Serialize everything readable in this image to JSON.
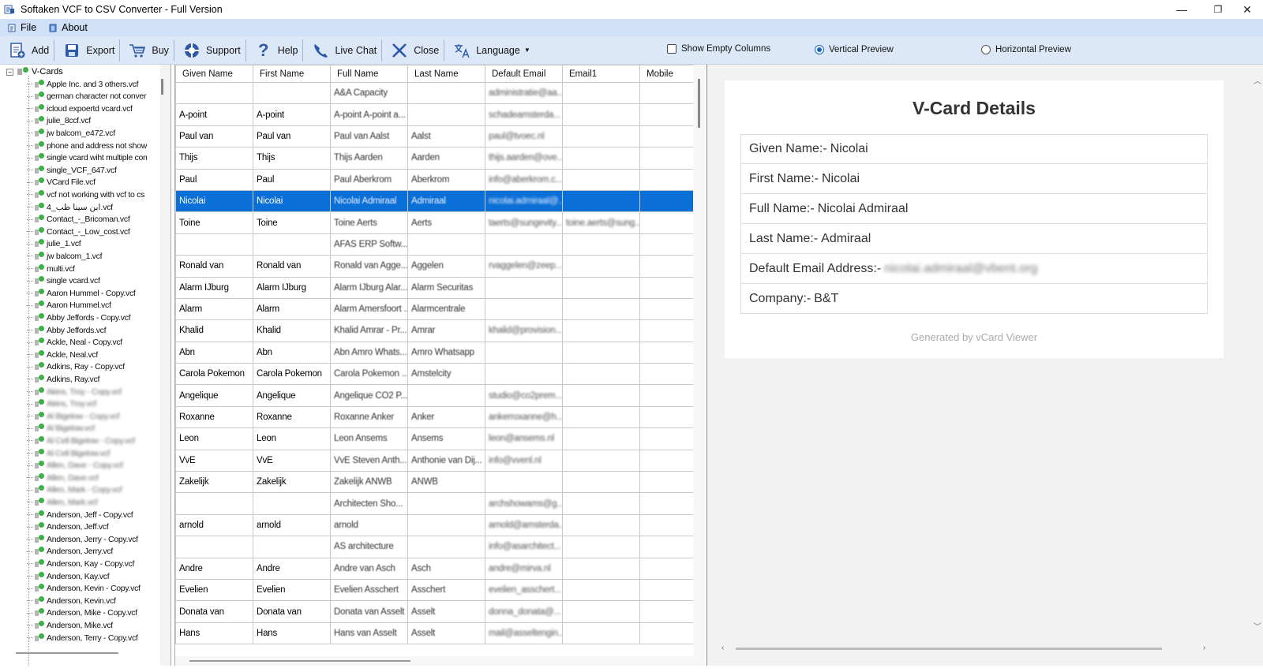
{
  "window": {
    "title": "Softaken VCF to CSV Converter - Full Version",
    "controls": [
      "—",
      "❐",
      "✕"
    ]
  },
  "menu": [
    {
      "label": "File",
      "icon": "file-icon"
    },
    {
      "label": "About",
      "icon": "about-icon"
    }
  ],
  "toolbar": {
    "buttons": [
      {
        "label": "Add",
        "icon": "add-icon"
      },
      {
        "label": "Export",
        "icon": "export-icon"
      },
      {
        "label": "Buy",
        "icon": "cart-icon"
      },
      {
        "label": "Support",
        "icon": "support-icon"
      },
      {
        "label": "Help",
        "icon": "help-icon"
      },
      {
        "label": "Live Chat",
        "icon": "phone-icon"
      },
      {
        "label": "Close",
        "icon": "close-icon"
      },
      {
        "label": "Language",
        "icon": "language-icon"
      }
    ],
    "show_empty_columns": {
      "label": "Show Empty Columns",
      "checked": false
    },
    "vertical_preview": {
      "label": "Vertical Preview",
      "selected": true
    },
    "horizontal_preview": {
      "label": "Horizontal Preview",
      "selected": false
    }
  },
  "tree": {
    "root": "V-Cards",
    "items": [
      {
        "label": "Apple Inc. and 3 others.vcf",
        "blur": false
      },
      {
        "label": "german character not conver",
        "blur": false
      },
      {
        "label": "icloud expoertd vcard.vcf",
        "blur": false
      },
      {
        "label": "julie_8ccf.vcf",
        "blur": false
      },
      {
        "label": "jw balcom_e472.vcf",
        "blur": false
      },
      {
        "label": "phone and address not show",
        "blur": false
      },
      {
        "label": "single vcard wiht multiple con",
        "blur": false
      },
      {
        "label": "single_VCF_647.vcf",
        "blur": false
      },
      {
        "label": "VCard File.vcf",
        "blur": false
      },
      {
        "label": "vcf not working with vcf to cs",
        "blur": false
      },
      {
        "label": "4_ابن سينا طب.vcf",
        "blur": false
      },
      {
        "label": "Contact_-_Bricoman.vcf",
        "blur": false
      },
      {
        "label": "Contact_-_Low_cost.vcf",
        "blur": false
      },
      {
        "label": "julie_1.vcf",
        "blur": false
      },
      {
        "label": "jw balcom_1.vcf",
        "blur": false
      },
      {
        "label": "multi.vcf",
        "blur": false
      },
      {
        "label": "single vcard.vcf",
        "blur": false
      },
      {
        "label": "Aaron Hummel - Copy.vcf",
        "blur": false
      },
      {
        "label": "Aaron Hummel.vcf",
        "blur": false
      },
      {
        "label": "Abby Jeffords - Copy.vcf",
        "blur": false
      },
      {
        "label": "Abby Jeffords.vcf",
        "blur": false
      },
      {
        "label": "Ackle, Neal - Copy.vcf",
        "blur": false
      },
      {
        "label": "Ackle, Neal.vcf",
        "blur": false
      },
      {
        "label": "Adkins, Ray - Copy.vcf",
        "blur": false
      },
      {
        "label": "Adkins, Ray.vcf",
        "blur": false
      },
      {
        "label": "Akins, Troy - Copy.vcf",
        "blur": true
      },
      {
        "label": "Akins, Troy.vcf",
        "blur": true
      },
      {
        "label": "Al Bigelow - Copy.vcf",
        "blur": true
      },
      {
        "label": "Al Bigelow.vcf",
        "blur": true
      },
      {
        "label": "Al Cell Bigelow - Copy.vcf",
        "blur": true
      },
      {
        "label": "Al Cell Bigelow.vcf",
        "blur": true
      },
      {
        "label": "Allen, Dave - Copy.vcf",
        "blur": true
      },
      {
        "label": "Allen, Dave.vcf",
        "blur": true
      },
      {
        "label": "Allen, Mark - Copy.vcf",
        "blur": true
      },
      {
        "label": "Allen, Mark.vcf",
        "blur": true
      },
      {
        "label": "Anderson, Jeff - Copy.vcf",
        "blur": false
      },
      {
        "label": "Anderson, Jeff.vcf",
        "blur": false
      },
      {
        "label": "Anderson, Jerry - Copy.vcf",
        "blur": false
      },
      {
        "label": "Anderson, Jerry.vcf",
        "blur": false
      },
      {
        "label": "Anderson, Kay - Copy.vcf",
        "blur": false
      },
      {
        "label": "Anderson, Kay.vcf",
        "blur": false
      },
      {
        "label": "Anderson, Kevin - Copy.vcf",
        "blur": false
      },
      {
        "label": "Anderson, Kevin.vcf",
        "blur": false
      },
      {
        "label": "Anderson, Mike - Copy.vcf",
        "blur": false
      },
      {
        "label": "Anderson, Mike.vcf",
        "blur": false
      },
      {
        "label": "Anderson, Terry - Copy.vcf",
        "blur": false
      }
    ]
  },
  "grid": {
    "columns": [
      "Given Name",
      "First Name",
      "Full Name",
      "Last Name",
      "Default Email",
      "Email1",
      "Mobile"
    ],
    "rows": [
      [
        "",
        "",
        "A&A Capacity",
        "",
        "administratie@aa...",
        "",
        ""
      ],
      [
        "A-point",
        "A-point",
        "A-point A-point a...",
        "",
        "schadeamsterda...",
        "",
        ""
      ],
      [
        "Paul van",
        "Paul van",
        "Paul van Aalst",
        "Aalst",
        "paul@tvoec.nl",
        "",
        ""
      ],
      [
        "Thijs",
        "Thijs",
        "Thijs Aarden",
        "Aarden",
        "thijs.aarden@ove...",
        "",
        ""
      ],
      [
        "Paul",
        "Paul",
        "Paul Aberkrom",
        "Aberkrom",
        "info@aberkrom.c...",
        "",
        ""
      ],
      [
        "Nicolai",
        "Nicolai",
        "Nicolai Admiraal",
        "Admiraal",
        "nicolai.admiraal@...",
        "",
        ""
      ],
      [
        "Toine",
        "Toine",
        "Toine Aerts",
        "Aerts",
        "taerts@sungevity...",
        "toine.aerts@sung...",
        ""
      ],
      [
        "",
        "",
        "AFAS ERP Softw...",
        "",
        "",
        "",
        ""
      ],
      [
        "Ronald van",
        "Ronald van",
        "Ronald van Agge...",
        "Aggelen",
        "rvaggelen@zeep...",
        "",
        ""
      ],
      [
        "Alarm IJburg",
        "Alarm IJburg",
        "Alarm IJburg Alar...",
        "Alarm Securitas",
        "",
        "",
        ""
      ],
      [
        "Alarm",
        "Alarm",
        "Alarm Amersfoort ...",
        "Alarmcentrale",
        "",
        "",
        ""
      ],
      [
        "Khalid",
        "Khalid",
        "Khalid Amrar - Pr...",
        "Amrar",
        "khalid@provision...",
        "",
        ""
      ],
      [
        "Abn",
        "Abn",
        "Abn Amro Whats...",
        "Amro Whatsapp",
        "",
        "",
        ""
      ],
      [
        "Carola Pokemon",
        "Carola Pokemon",
        "Carola Pokemon ...",
        "Amstelcity",
        "",
        "",
        ""
      ],
      [
        "Angelique",
        "Angelique",
        "Angelique CO2 P...",
        "",
        "studio@co2prem...",
        "",
        ""
      ],
      [
        "Roxanne",
        "Roxanne",
        "Roxanne Anker",
        "Anker",
        "ankerroxanne@h...",
        "",
        ""
      ],
      [
        "Leon",
        "Leon",
        "Leon Ansems",
        "Ansems",
        "leon@ansems.nl",
        "",
        ""
      ],
      [
        "VvE",
        "VvE",
        "VvE Steven Anth...",
        "Anthonie van Dij...",
        "info@vvenl.nl",
        "",
        ""
      ],
      [
        "Zakelijk",
        "Zakelijk",
        "Zakelijk ANWB",
        "ANWB",
        "",
        "",
        ""
      ],
      [
        "",
        "",
        "Architecten Sho...",
        "",
        "archshowams@g...",
        "",
        ""
      ],
      [
        "arnold",
        "arnold",
        "arnold",
        "",
        "arnold@amsterda...",
        "",
        ""
      ],
      [
        "",
        "",
        "AS architecture",
        "",
        "info@asarchitect...",
        "",
        ""
      ],
      [
        "Andre",
        "Andre",
        "Andre van Asch",
        "Asch",
        "andre@mirva.nl",
        "",
        ""
      ],
      [
        "Evelien",
        "Evelien",
        "Evelien Asschert",
        "Asschert",
        "evelien_asschert...",
        "",
        ""
      ],
      [
        "Donata van",
        "Donata van",
        "Donata van Asselt",
        "Asselt",
        "donna_donata@...",
        "",
        ""
      ],
      [
        "Hans",
        "Hans",
        "Hans van Asselt",
        "Asselt",
        "mail@asseltengin...",
        "",
        ""
      ]
    ],
    "selected_row": 5
  },
  "preview": {
    "title": "V-Card Details",
    "fields": [
      {
        "label": "Given Name:-",
        "value": "Nicolai",
        "blur": false
      },
      {
        "label": "First Name:-",
        "value": "Nicolai",
        "blur": false
      },
      {
        "label": "Full Name:-",
        "value": "Nicolai Admiraal",
        "blur": false
      },
      {
        "label": "Last Name:-",
        "value": "Admiraal",
        "blur": false
      },
      {
        "label": "Default Email Address:-",
        "value": "nicolai.admiraal@vbent.org",
        "blur": true
      },
      {
        "label": "Company:-",
        "value": "B&T",
        "blur": false
      }
    ],
    "footer": "Generated by vCard Viewer"
  },
  "colors": {
    "menubar": "#cfe0f7",
    "toolbar": "#dce8f8",
    "selection": "#0a6fd6",
    "accent": "#1565c0"
  }
}
